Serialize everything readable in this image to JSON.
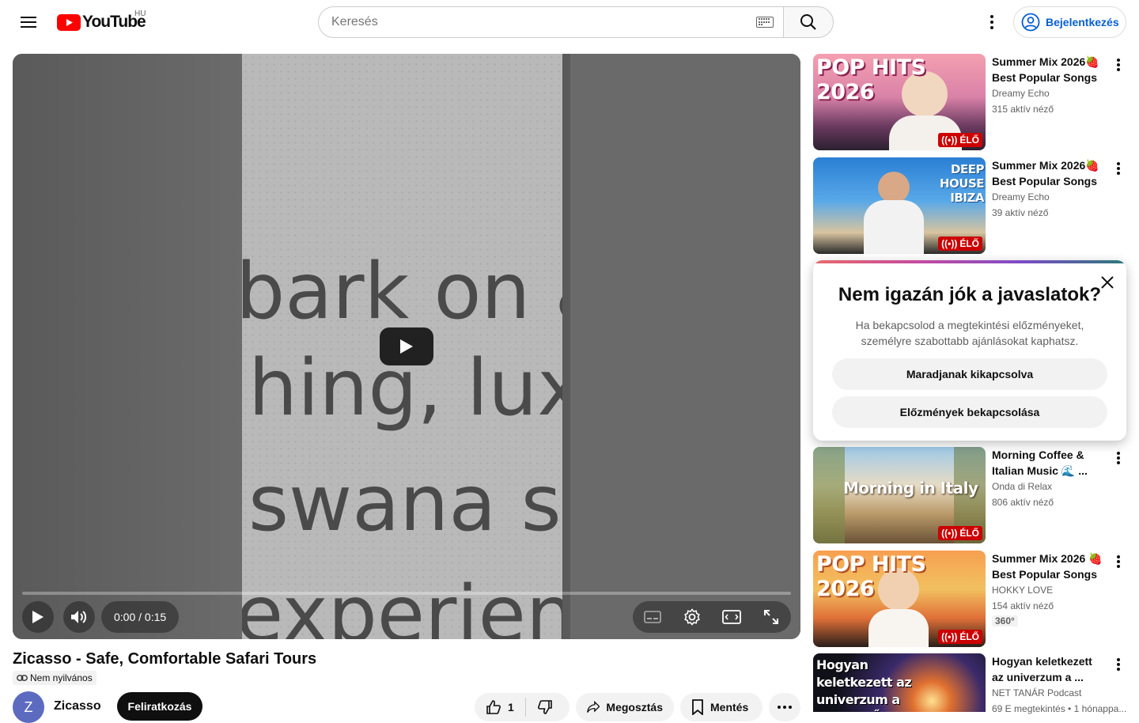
{
  "header": {
    "logo_text": "YouTube",
    "country_code": "HU",
    "search_placeholder": "Keresés",
    "signin_label": "Bejelentkezés"
  },
  "player": {
    "overlay_lines": [
      "bark on a",
      "hing, luxu",
      "swana sa",
      "experienc"
    ],
    "time_current": "0:00",
    "time_separator": "/",
    "time_total": "0:15",
    "progress": 0
  },
  "video": {
    "title": "Zicasso - Safe, Comfortable Safari Tours",
    "privacy": "Nem nyilvános",
    "channel_initial": "Z",
    "channel_name": "Zicasso",
    "subscribe_label": "Feliratkozás",
    "like_count": "1",
    "share_label": "Megosztás",
    "save_label": "Mentés"
  },
  "recommendations": [
    {
      "thumb_text": "POP HITS 2026",
      "title": "Summer Mix 2026🍓 Best Popular Songs ...",
      "channel": "Dreamy Echo",
      "meta": "315 aktív néző",
      "live": "ÉLŐ"
    },
    {
      "thumb_text": "DEEP HOUSE IBIZA",
      "title": "Summer Mix 2026🍓 Best Popular Songs ...",
      "channel": "Dreamy Echo",
      "meta": "39 aktív néző",
      "live": "ÉLŐ"
    },
    {
      "thumb_text": "Morning in Italy",
      "title": "Morning Coffee & Italian Music 🌊 ...",
      "channel": "Onda di Relax",
      "meta": "806 aktív néző",
      "live": "ÉLŐ"
    },
    {
      "thumb_text": "POP HITS 2026",
      "title": "Summer Mix 2026 🍓 Best Popular Songs ...",
      "channel": "HOKKY LOVE",
      "meta": "154 aktív néző",
      "live": "ÉLŐ",
      "badge": "360°"
    },
    {
      "thumb_text": "Hogyan keletkezett az univerzum a SEMMIBŐL?",
      "title": "Hogyan keletkezett az univerzum a ...",
      "channel": "NET TANÁR Podcast",
      "meta": "69 E megtekintés • 1 hónappa..."
    }
  ],
  "popup": {
    "title": "Nem igazán jók a javaslatok?",
    "text": "Ha bekapcsolod a megtekintési előzményeket, személyre szabottabb ajánlásokat kaphatsz.",
    "keep_off_label": "Maradjanak kikapcsolva",
    "turn_on_label": "Előzmények bekapcsolása"
  },
  "colors": {
    "brand_red": "#ff0000",
    "link_blue": "#065fd4",
    "live_red": "#cc0000"
  }
}
